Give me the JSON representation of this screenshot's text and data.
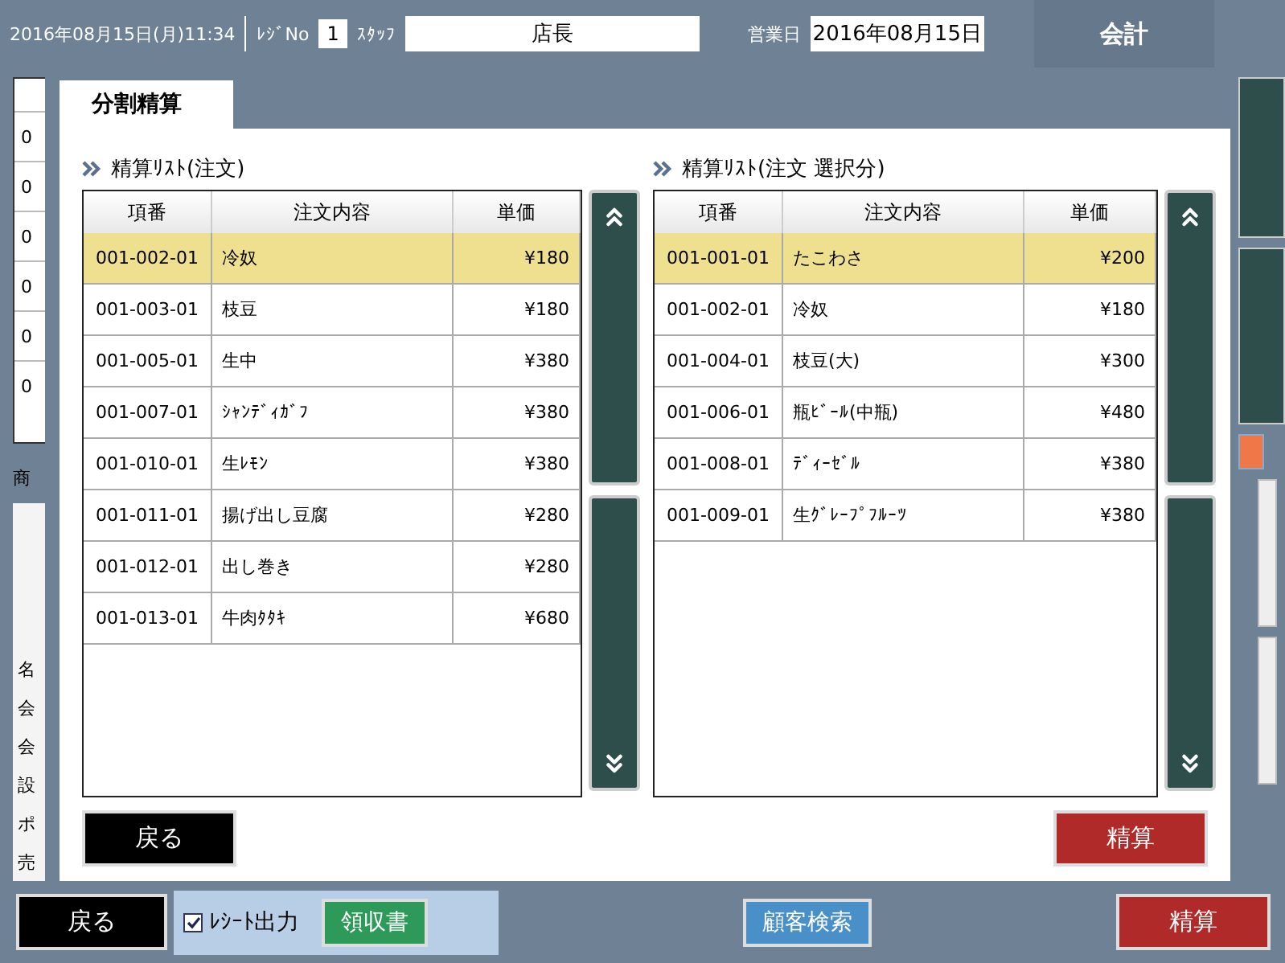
{
  "header": {
    "datetime": "2016年08月15日(月)11:34",
    "register_label": "ﾚｼﾞNo",
    "register_no": "1",
    "staff_label": "ｽﾀｯﾌ",
    "staff": "店長",
    "business_day_label": "営業日",
    "business_day": "2016年08月15日",
    "mode": "会計"
  },
  "background": {
    "cells": [
      "0",
      "0",
      "0",
      "0",
      "0",
      "0"
    ],
    "section_label": "商",
    "labels": [
      "名",
      "会",
      "会",
      "設",
      "ポ",
      "売"
    ]
  },
  "dialog": {
    "tab": "分割精算",
    "lists": [
      {
        "title": "精算ﾘｽﾄ(注文)",
        "columns": [
          "項番",
          "注文内容",
          "単価"
        ],
        "rows": [
          {
            "no": "001-002-01",
            "item": "冷奴",
            "price": "¥180",
            "selected": true
          },
          {
            "no": "001-003-01",
            "item": "枝豆",
            "price": "¥180",
            "selected": false
          },
          {
            "no": "001-005-01",
            "item": "生中",
            "price": "¥380",
            "selected": false
          },
          {
            "no": "001-007-01",
            "item": "ｼｬﾝﾃﾞｨｶﾞﾌ",
            "price": "¥380",
            "selected": false
          },
          {
            "no": "001-010-01",
            "item": "生ﾚﾓﾝ",
            "price": "¥380",
            "selected": false
          },
          {
            "no": "001-011-01",
            "item": "揚げ出し豆腐",
            "price": "¥280",
            "selected": false
          },
          {
            "no": "001-012-01",
            "item": "出し巻き",
            "price": "¥280",
            "selected": false
          },
          {
            "no": "001-013-01",
            "item": "牛肉ﾀﾀｷ",
            "price": "¥680",
            "selected": false
          }
        ]
      },
      {
        "title": "精算ﾘｽﾄ(注文 選択分)",
        "columns": [
          "項番",
          "注文内容",
          "単価"
        ],
        "rows": [
          {
            "no": "001-001-01",
            "item": "たこわさ",
            "price": "¥200",
            "selected": true
          },
          {
            "no": "001-002-01",
            "item": "冷奴",
            "price": "¥180",
            "selected": false
          },
          {
            "no": "001-004-01",
            "item": "枝豆(大)",
            "price": "¥300",
            "selected": false
          },
          {
            "no": "001-006-01",
            "item": "瓶ﾋﾞｰﾙ(中瓶)",
            "price": "¥480",
            "selected": false
          },
          {
            "no": "001-008-01",
            "item": "ﾃﾞｨｰｾﾞﾙ",
            "price": "¥380",
            "selected": false
          },
          {
            "no": "001-009-01",
            "item": "生ｸﾞﾚｰﾌﾟﾌﾙｰﾂ",
            "price": "¥380",
            "selected": false
          }
        ]
      }
    ],
    "back_button": "戻る",
    "settle_button": "精算"
  },
  "footer": {
    "back_button": "戻る",
    "receipt": {
      "label": "ﾚｼｰﾄ出力",
      "checked": true
    },
    "receipt_button": "領収書",
    "customer_search_button": "顧客検索",
    "settle_button": "精算"
  }
}
